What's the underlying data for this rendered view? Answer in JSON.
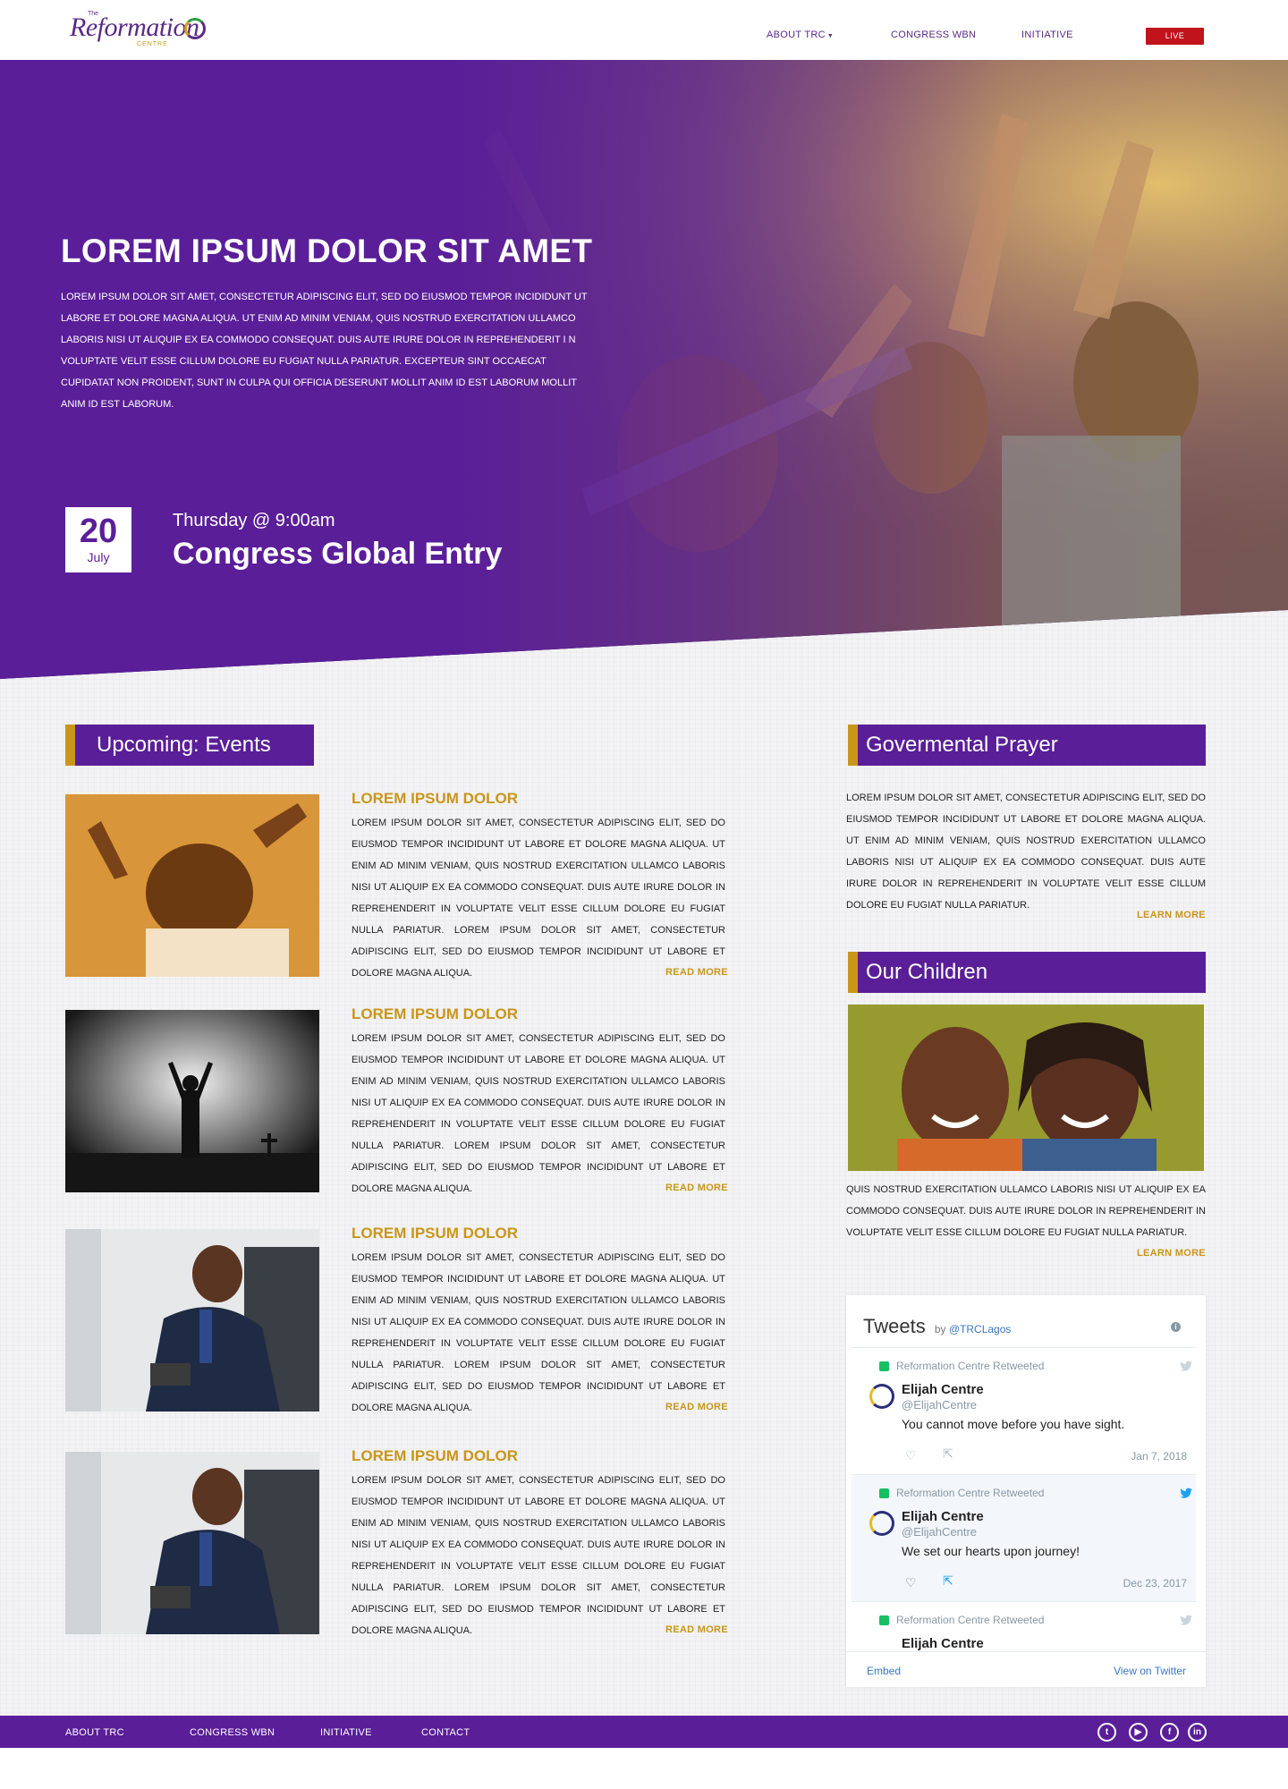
{
  "header": {
    "logo": {
      "the": "The",
      "name": "Reformation",
      "sub": "CENTRE"
    },
    "nav": [
      {
        "label": "ABOUT TRC"
      },
      {
        "label": "CONGRESS WBN"
      },
      {
        "label": "INITIATIVE"
      }
    ],
    "live_label": "LIVE"
  },
  "hero": {
    "title": "LOREM IPSUM DOLOR SIT AMET",
    "body": "LOREM IPSUM DOLOR SIT AMET, CONSECTETUR ADIPISCING ELIT, SED DO EIUSMOD TEMPOR INCIDIDUNT UT LABORE ET DOLORE MAGNA ALIQUA. UT ENIM AD MINIM VENIAM, QUIS NOSTRUD EXERCITATION ULLAMCO LABORIS NISI UT ALIQUIP EX EA COMMODO CONSEQUAT. DUIS AUTE IRURE DOLOR IN REPREHENDERIT I N VOLUPTATE VELIT ESSE CILLUM DOLORE EU FUGIAT NULLA PARIATUR. EXCEPTEUR SINT OCCAECAT CUPIDATAT NON PROIDENT, SUNT IN CULPA QUI OFFICIA DESERUNT MOLLIT ANIM ID EST LABORUM MOLLIT ANIM ID EST LABORUM.",
    "event": {
      "day": "20",
      "month": "July",
      "time": "Thursday @ 9:00am",
      "name": "Congress Global Entry"
    }
  },
  "events": {
    "heading": "Upcoming: Events",
    "items": [
      {
        "title": "LOREM IPSUM DOLOR",
        "body": "LOREM IPSUM DOLOR SIT AMET, CONSECTETUR ADIPISCING ELIT, SED DO EIUSMOD TEMPOR INCIDIDUNT UT LABORE ET DOLORE MAGNA ALIQUA. UT ENIM AD MINIM VENIAM, QUIS NOSTRUD EXERCITATION ULLAMCO LABORIS NISI UT ALIQUIP EX EA COMMODO CONSEQUAT. DUIS AUTE IRURE DOLOR IN REPREHENDERIT IN VOLUPTATE VELIT ESSE CILLUM DOLORE EU FUGIAT NULLA PARIATUR. LOREM IPSUM DOLOR SIT AMET, CONSECTETUR ADIPISCING ELIT, SED DO EIUSMOD TEMPOR INCIDIDUNT UT LABORE ET DOLORE MAGNA ALIQUA.",
        "read_more": "READ MORE"
      },
      {
        "title": "LOREM IPSUM DOLOR",
        "body": "LOREM IPSUM DOLOR SIT AMET, CONSECTETUR ADIPISCING ELIT, SED DO EIUSMOD TEMPOR INCIDIDUNT UT LABORE ET DOLORE MAGNA ALIQUA. UT ENIM AD MINIM VENIAM, QUIS NOSTRUD EXERCITATION ULLAMCO LABORIS NISI UT ALIQUIP EX EA COMMODO CONSEQUAT. DUIS AUTE IRURE DOLOR IN REPREHENDERIT IN VOLUPTATE VELIT ESSE CILLUM DOLORE EU FUGIAT NULLA PARIATUR. LOREM IPSUM DOLOR SIT AMET, CONSECTETUR ADIPISCING ELIT, SED DO EIUSMOD TEMPOR INCIDIDUNT UT LABORE ET DOLORE MAGNA ALIQUA.",
        "read_more": "READ MORE"
      },
      {
        "title": "LOREM IPSUM DOLOR",
        "body": "LOREM IPSUM DOLOR SIT AMET, CONSECTETUR ADIPISCING ELIT, SED DO EIUSMOD TEMPOR INCIDIDUNT UT LABORE ET DOLORE MAGNA ALIQUA. UT ENIM AD MINIM VENIAM, QUIS NOSTRUD EXERCITATION ULLAMCO LABORIS NISI UT ALIQUIP EX EA COMMODO CONSEQUAT. DUIS AUTE IRURE DOLOR IN REPREHENDERIT IN VOLUPTATE VELIT ESSE CILLUM DOLORE EU FUGIAT NULLA PARIATUR. LOREM IPSUM DOLOR SIT AMET, CONSECTETUR ADIPISCING ELIT, SED DO EIUSMOD TEMPOR INCIDIDUNT UT LABORE ET DOLORE MAGNA ALIQUA.",
        "read_more": "READ MORE"
      },
      {
        "title": "LOREM IPSUM DOLOR",
        "body": "LOREM IPSUM DOLOR SIT AMET, CONSECTETUR ADIPISCING ELIT, SED DO EIUSMOD TEMPOR INCIDIDUNT UT LABORE ET DOLORE MAGNA ALIQUA. UT ENIM AD MINIM VENIAM, QUIS NOSTRUD EXERCITATION ULLAMCO LABORIS NISI UT ALIQUIP EX EA COMMODO CONSEQUAT. DUIS AUTE IRURE DOLOR IN REPREHENDERIT IN VOLUPTATE VELIT ESSE CILLUM DOLORE EU FUGIAT NULLA PARIATUR. LOREM IPSUM DOLOR SIT AMET, CONSECTETUR ADIPISCING ELIT, SED DO EIUSMOD TEMPOR INCIDIDUNT UT LABORE ET DOLORE MAGNA ALIQUA.",
        "read_more": "READ MORE"
      }
    ]
  },
  "prayer": {
    "heading": "Govermental Prayer",
    "body": "LOREM IPSUM DOLOR SIT AMET, CONSECTETUR ADIPISCING ELIT, SED DO EIUSMOD TEMPOR INCIDIDUNT UT LABORE ET DOLORE MAGNA ALIQUA. UT ENIM AD MINIM VENIAM, QUIS NOSTRUD EXERCITATION ULLAMCO LABORIS NISI UT ALIQUIP EX EA COMMODO CONSEQUAT. DUIS AUTE IRURE DOLOR IN REPREHENDERIT IN VOLUPTATE VELIT ESSE CILLUM DOLORE EU FUGIAT NULLA PARIATUR.",
    "learn_more": "LEARN MORE"
  },
  "children": {
    "heading": "Our Children",
    "body": "QUIS NOSTRUD EXERCITATION ULLAMCO LABORIS NISI UT ALIQUIP EX EA COMMODO CONSEQUAT. DUIS AUTE IRURE DOLOR IN REPREHENDERIT IN VOLUPTATE VELIT ESSE CILLUM DOLORE EU FUGIAT NULLA PARIATUR.",
    "learn_more": "LEARN MORE"
  },
  "tweets": {
    "title": "Tweets",
    "by": "by",
    "handle": "@TRCLagos",
    "items": [
      {
        "retweet": "Reformation Centre Retweeted",
        "name": "Elijah Centre",
        "user": "@ElijahCentre",
        "text": "You cannot move before you have sight.",
        "date": "Jan 7, 2018"
      },
      {
        "retweet": "Reformation Centre Retweeted",
        "name": "Elijah Centre",
        "user": "@ElijahCentre",
        "text": "We set our hearts upon journey!",
        "date": "Dec 23, 2017"
      },
      {
        "retweet": "Reformation Centre Retweeted",
        "name": "Elijah Centre",
        "user": "",
        "text": "",
        "date": ""
      }
    ],
    "embed": "Embed",
    "view_on_twitter": "View on Twitter"
  },
  "footer": {
    "links": [
      {
        "label": "ABOUT TRC"
      },
      {
        "label": "CONGRESS WBN"
      },
      {
        "label": "INITIATIVE"
      },
      {
        "label": "CONTACT"
      }
    ],
    "social": [
      "twitter-icon",
      "youtube-icon",
      "facebook-icon",
      "linkedin-icon"
    ]
  },
  "colors": {
    "brand_purple": "#5a1e99",
    "accent_gold": "#c9961a",
    "live_red": "#c0131b"
  }
}
